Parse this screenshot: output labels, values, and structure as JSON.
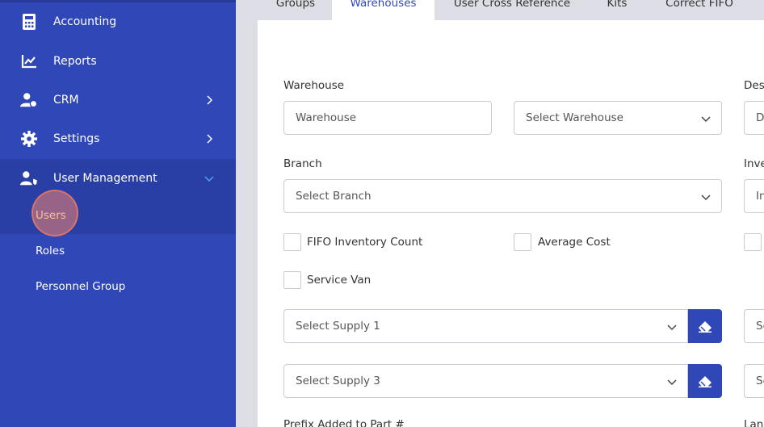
{
  "sidebar": {
    "items": [
      {
        "label": "Accounting",
        "icon": "calculator-icon"
      },
      {
        "label": "Reports",
        "icon": "chart-line-icon"
      },
      {
        "label": "CRM",
        "icon": "user-contact-icon"
      },
      {
        "label": "Settings",
        "icon": "gear-icon"
      },
      {
        "label": "User Management",
        "icon": "user-shield-icon"
      }
    ],
    "subitems": [
      "Users",
      "Roles",
      "Personnel Group"
    ]
  },
  "tabs": [
    "Groups",
    "Warehouses",
    "User Cross Reference",
    "Kits",
    "Correct FIFO"
  ],
  "form": {
    "warehouse_label": "Warehouse",
    "warehouse_placeholder": "Warehouse",
    "select_warehouse": "Select Warehouse",
    "description_label": "Des",
    "description_value": "D",
    "branch_label": "Branch",
    "select_branch": "Select Branch",
    "inventory_label": "Inve",
    "inventory_value": "In",
    "fifo_label": "FIFO Inventory Count",
    "average_cost_label": "Average Cost",
    "service_van_label": "Service Van",
    "supply1": "Select Supply 1",
    "supply1_right": "Se",
    "supply3": "Select Supply 3",
    "supply3_right": "Se",
    "prefix_label": "Prefix Added to Part #",
    "lan_label": "Lan"
  },
  "colors": {
    "sidebar": "#3047b8",
    "active_sub": "#f5c58c",
    "accent": "#3047b8"
  }
}
